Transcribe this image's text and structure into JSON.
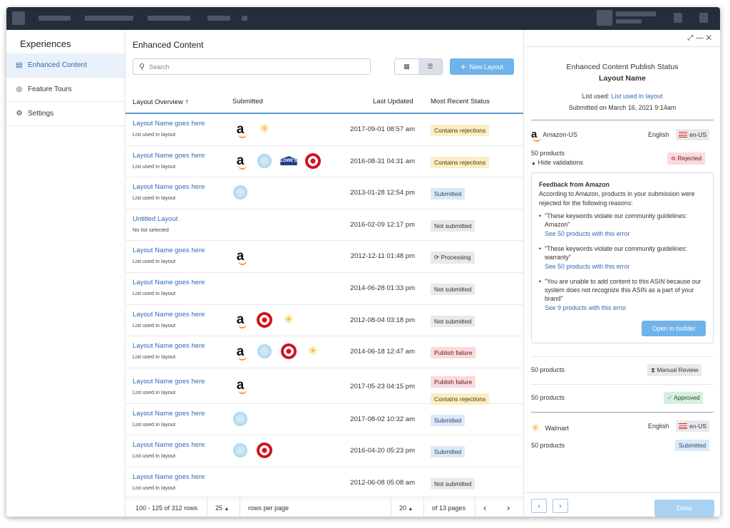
{
  "sidebar": {
    "title": "Experiences",
    "items": [
      {
        "label": "Enhanced Content",
        "icon": "document-icon"
      },
      {
        "label": "Feature Tours",
        "icon": "tour-icon"
      },
      {
        "label": "Settings",
        "icon": "gear-icon"
      }
    ]
  },
  "main": {
    "title": "Enhanced Content",
    "search_placeholder": "Search",
    "new_layout_label": "New Layout"
  },
  "table": {
    "columns": [
      "Layout Overview",
      "Submitted",
      "Last Updated",
      "Most Recent Status"
    ],
    "rows": [
      {
        "name": "Layout Name goes here",
        "list": "List used in layout",
        "logos": [
          "amazon",
          "walmart"
        ],
        "updated": "2017-09-01 08:57 am",
        "status": [
          "Contains rejections"
        ]
      },
      {
        "name": "Layout Name goes here",
        "list": "List used in layout",
        "logos": [
          "amazon",
          "flake",
          "lowes",
          "target"
        ],
        "updated": "2016-08-31 04:31 am",
        "status": [
          "Contains rejections"
        ]
      },
      {
        "name": "Layout Name goes here",
        "list": "List used in layout",
        "logos": [
          "flake"
        ],
        "updated": "2013-01-28 12:54 pm",
        "status": [
          "Submitted"
        ]
      },
      {
        "name": "Untitled Layout",
        "list": "No list selected",
        "logos": [],
        "updated": "2016-02-09 12:17 pm",
        "status": [
          "Not submitted"
        ]
      },
      {
        "name": "Layout Name goes here",
        "list": "List used in layout",
        "logos": [
          "amazon"
        ],
        "updated": "2012-12-11 01:48 pm",
        "status": [
          "Processing"
        ]
      },
      {
        "name": "Layout Name goes here",
        "list": "List used in layout",
        "logos": [],
        "updated": "2014-06-28 01:33 pm",
        "status": [
          "Not submitted"
        ]
      },
      {
        "name": "Layout Name goes here",
        "list": "List used in layout",
        "logos": [
          "amazon",
          "target",
          "walmart"
        ],
        "updated": "2012-08-04 03:18 pm",
        "status": [
          "Not submitted"
        ]
      },
      {
        "name": "Layout Name goes here",
        "list": "List used in layout",
        "logos": [
          "amazon",
          "flake",
          "target",
          "walmart"
        ],
        "updated": "2014-06-18 12:47 am",
        "status": [
          "Publish failure"
        ]
      },
      {
        "name": "Layout Name goes here",
        "list": "List used in layout",
        "logos": [
          "amazon"
        ],
        "updated": "2017-05-23 04:15 pm",
        "status": [
          "Publish failure",
          "Contains rejections"
        ]
      },
      {
        "name": "Layout Name goes here",
        "list": "List used in layout",
        "logos": [
          "flake"
        ],
        "updated": "2017-08-02 10:32 am",
        "status": [
          "Submitted"
        ]
      },
      {
        "name": "Layout Name goes here",
        "list": "List used in layout",
        "logos": [
          "flake",
          "target"
        ],
        "updated": "2016-04-20 05:23 pm",
        "status": [
          "Submitted"
        ]
      },
      {
        "name": "Layout Name goes here",
        "list": "List used in layout",
        "logos": [],
        "updated": "2012-06-08 05:08 am",
        "status": [
          "Not submitted"
        ]
      }
    ]
  },
  "pager": {
    "range": "100 - 125 of 312 rows",
    "per_page": "25",
    "per_page_label": "rows per page",
    "page": "20",
    "of_pages": "of 13 pages"
  },
  "panel": {
    "heading": "Enhanced Content Publish Status",
    "layout_name": "Layout Name",
    "list_used_label": "List used:",
    "list_used_link": "List used in layout",
    "submitted_on": "Submitted on March 16, 2021 9:14am",
    "amazon": {
      "name": "Amazon-US",
      "language": "English",
      "locale": "en-US",
      "products": "50 products",
      "hide": "Hide validations",
      "status": "Rejected"
    },
    "feedback": {
      "title": "Feedback from Amazon",
      "intro": "According to Amazon, products in your submission were rejected for the following reasons:",
      "items": [
        {
          "text": "\"These keywords violate our community guidelines: Amazon\"",
          "link": "See 50 products with this error"
        },
        {
          "text": "\"These keywords violate our community guidelines: warranty\"",
          "link": "See 50 products with this error"
        },
        {
          "text": "\"You are unable to add content to this ASIN because our system does not recognize this ASIN as a part of your brand\"",
          "link": "See 9 products with this error"
        }
      ],
      "open_builder": "Open in builder"
    },
    "group2": {
      "products": "50 products",
      "status": "Manual Review"
    },
    "group3": {
      "products": "50 products",
      "status": "Approved"
    },
    "walmart": {
      "name": "Walmart",
      "language": "English",
      "locale": "en-US",
      "products": "50 products",
      "status": "Submitted"
    },
    "done": "Done"
  }
}
